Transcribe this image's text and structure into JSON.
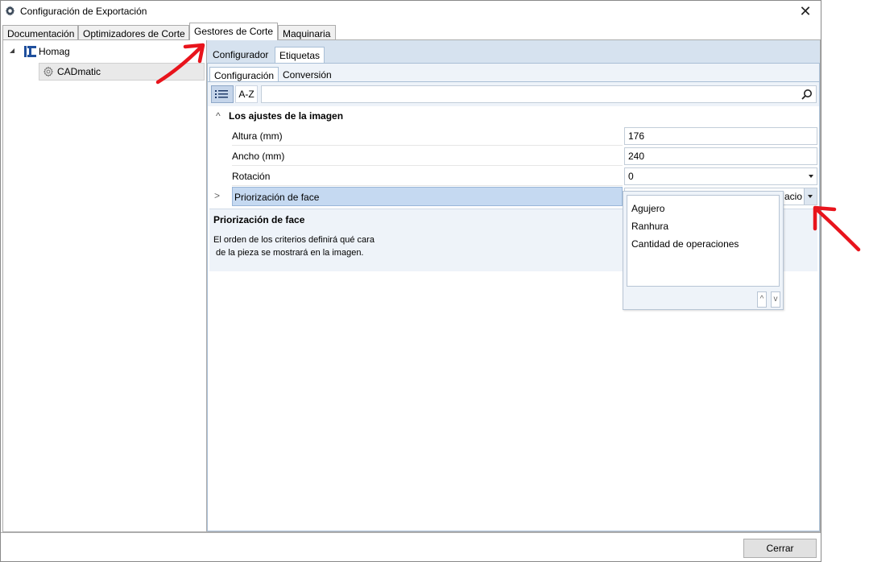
{
  "window": {
    "title": "Configuración de Exportación",
    "close_glyph": "✕"
  },
  "main_tabs": [
    {
      "label": "Documentación"
    },
    {
      "label": "Optimizadores de Corte"
    },
    {
      "label": "Gestores de Corte"
    },
    {
      "label": "Maquinaria"
    }
  ],
  "tree": {
    "root": {
      "label": "Homag",
      "icon": "homag-logo-icon"
    },
    "child": {
      "label": "CADmatic",
      "icon": "gear-icon"
    }
  },
  "sub_tabs": [
    {
      "label": "Configurador"
    },
    {
      "label": "Etiquetas"
    }
  ],
  "etiquetas_tabs": [
    {
      "label": "Configuración"
    },
    {
      "label": "Conversión"
    }
  ],
  "toolbar": {
    "categorized_icon": "categorized-list-icon",
    "az_label": "A-Z",
    "search_icon": "magnifier-icon"
  },
  "property_grid": {
    "category": "Los ajustes de la imagen",
    "rows": [
      {
        "name": "Altura (mm)",
        "value": "176"
      },
      {
        "name": "Ancho (mm)",
        "value": "240"
      },
      {
        "name": "Rotación",
        "value": "0"
      },
      {
        "name": "Priorización de face",
        "value": "acio"
      }
    ]
  },
  "description": {
    "title": "Priorización de face",
    "text": "El orden de los criterios definirá qué cara\n de la pieza se mostrará en la imagen."
  },
  "popup": {
    "items": [
      "Agujero",
      "Ranhura",
      "Cantidad de operaciones"
    ],
    "up_label": "^",
    "down_label": "v"
  },
  "buttons": {
    "close_label": "Cerrar"
  },
  "colors": {
    "annotation_arrow": "#e8141c",
    "selected_row": "#c5d9f1",
    "panel_bg": "#d6e2ef"
  }
}
